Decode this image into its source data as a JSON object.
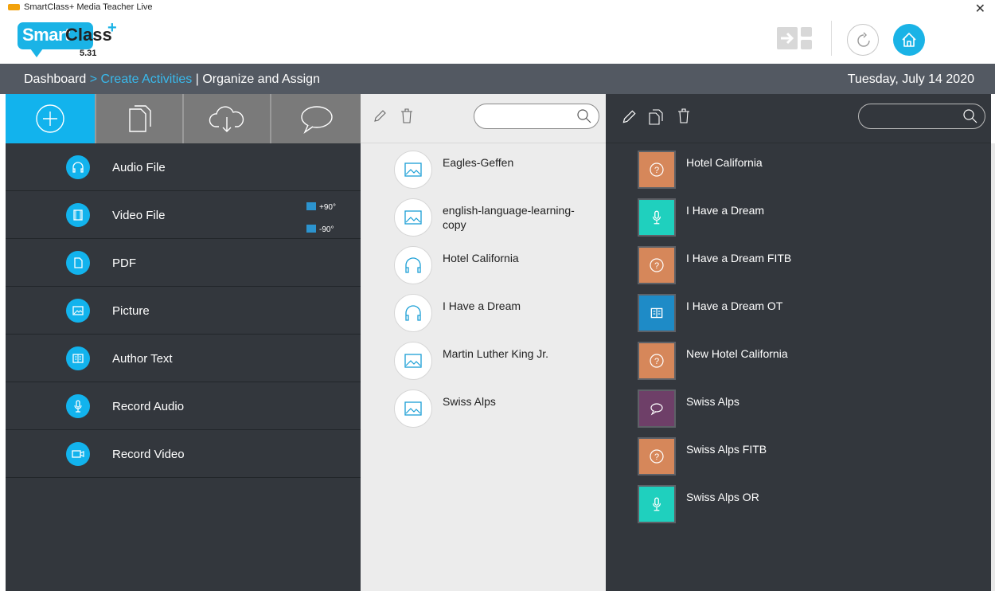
{
  "window": {
    "title": "SmartClass+ Media Teacher Live",
    "close_glyph": "✕"
  },
  "logo": {
    "brand_smart": "Smart",
    "brand_class": "Class",
    "plus": "+",
    "version": "5.31"
  },
  "header": {
    "icons": [
      "switch-view-icon",
      "refresh-icon",
      "home-icon"
    ],
    "accent": "#1ab3e6"
  },
  "nav": {
    "crumb_dashboard": "Dashboard",
    "crumb_sep": ">",
    "crumb_create": "Create Activities",
    "crumb_pipe": "|",
    "crumb_organize": "Organize and Assign",
    "date": "Tuesday, July 14 2020"
  },
  "left_tabs": [
    {
      "icon": "add-icon",
      "selected": true
    },
    {
      "icon": "documents-icon",
      "selected": false
    },
    {
      "icon": "cloud-download-icon",
      "selected": false
    },
    {
      "icon": "chat-bubble-icon",
      "selected": false
    }
  ],
  "create_menu": [
    {
      "label": "Audio File",
      "icon": "headphones-icon"
    },
    {
      "label": "Video File",
      "icon": "film-icon"
    },
    {
      "label": "PDF",
      "icon": "document-icon"
    },
    {
      "label": "Picture",
      "icon": "picture-icon"
    },
    {
      "label": "Author Text",
      "icon": "book-icon"
    },
    {
      "label": "Record Audio",
      "icon": "microphone-icon"
    },
    {
      "label": "Record Video",
      "icon": "video-camera-icon"
    }
  ],
  "video_rotation": {
    "plus": "+90°",
    "minus": "-90°"
  },
  "media_toolbar": {
    "icons": [
      "edit-icon",
      "trash-icon"
    ],
    "search_value": "",
    "search_placeholder": ""
  },
  "media_items": [
    {
      "label": "Eagles-Geffen",
      "icon": "picture-icon"
    },
    {
      "label": "english-language-learning-copy",
      "icon": "picture-icon"
    },
    {
      "label": "Hotel California",
      "icon": "headphones-icon"
    },
    {
      "label": "I Have a Dream",
      "icon": "headphones-icon"
    },
    {
      "label": "Martin Luther King Jr.",
      "icon": "picture-icon"
    },
    {
      "label": "Swiss Alps",
      "icon": "picture-icon"
    }
  ],
  "activity_toolbar": {
    "icons": [
      "edit-icon",
      "copy-icon",
      "trash-icon"
    ],
    "search_value": "",
    "search_placeholder": ""
  },
  "activities": [
    {
      "label": "Hotel California",
      "icon": "question-icon",
      "color": "#d6875a"
    },
    {
      "label": "I Have a Dream",
      "icon": "microphone-icon",
      "color": "#1fd0be"
    },
    {
      "label": "I Have a Dream FITB",
      "icon": "question-icon",
      "color": "#d6875a"
    },
    {
      "label": "I Have a Dream OT",
      "icon": "book-icon",
      "color": "#1e8bc7"
    },
    {
      "label": "New Hotel California",
      "icon": "question-icon",
      "color": "#d6875a"
    },
    {
      "label": "Swiss Alps",
      "icon": "chat-bubble-icon",
      "color": "#6e3f68"
    },
    {
      "label": "Swiss Alps FITB",
      "icon": "question-icon",
      "color": "#d6875a"
    },
    {
      "label": "Swiss Alps OR",
      "icon": "microphone-icon",
      "color": "#1fd0be"
    }
  ]
}
